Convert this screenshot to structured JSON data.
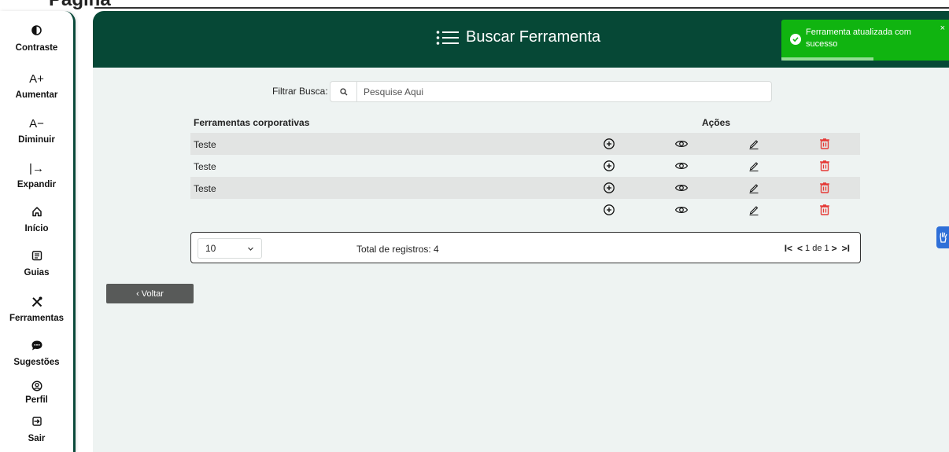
{
  "top": {
    "cut_text": "Página"
  },
  "sidebar": {
    "items": [
      {
        "label": "Contraste",
        "icon": "contrast-icon"
      },
      {
        "label": "Aumentar",
        "icon": "font-increase-icon",
        "glyph": "A+"
      },
      {
        "label": "Diminuir",
        "icon": "font-decrease-icon",
        "glyph": "A−"
      },
      {
        "label": "Expandir",
        "icon": "expand-icon",
        "glyph": "|→"
      },
      {
        "label": "Início",
        "icon": "home-icon"
      },
      {
        "label": "Guias",
        "icon": "guide-icon"
      },
      {
        "label": "Ferramentas",
        "icon": "tools-icon"
      },
      {
        "label": "Sugestões",
        "icon": "chat-icon"
      },
      {
        "label": "Perfil",
        "icon": "profile-icon"
      },
      {
        "label": "Sair",
        "icon": "logout-icon"
      }
    ]
  },
  "header": {
    "title": "Buscar Ferramenta"
  },
  "filter": {
    "label": "Filtrar Busca:",
    "placeholder": "Pesquise Aqui",
    "value": ""
  },
  "table": {
    "col_name": "Ferramentas corporativas",
    "col_actions": "Ações",
    "rows": [
      {
        "name": "Teste"
      },
      {
        "name": "Teste"
      },
      {
        "name": "Teste"
      },
      {
        "name": ""
      }
    ]
  },
  "pager": {
    "page_size": "10",
    "total": "Total de registros: 4",
    "page_info": "1 de 1",
    "first": "I<",
    "prev": "<",
    "next": ">",
    "last": ">I"
  },
  "back_button": "‹ Voltar",
  "toast": {
    "message": "Ferramenta atualizada com sucesso",
    "close": "×",
    "progress": 0.55
  },
  "colors": {
    "header_bg": "#064836",
    "toast_bg": "#10b410",
    "delete_icon": "#e53935",
    "back_button_bg": "#585a59"
  }
}
